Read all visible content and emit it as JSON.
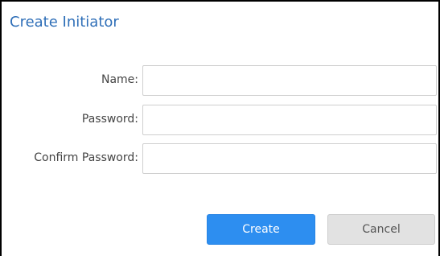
{
  "dialog": {
    "title": "Create Initiator"
  },
  "form": {
    "name": {
      "label": "Name:",
      "value": ""
    },
    "password": {
      "label": "Password:",
      "value": ""
    },
    "confirm_password": {
      "label": "Confirm Password:",
      "value": ""
    }
  },
  "buttons": {
    "create_label": "Create",
    "cancel_label": "Cancel"
  },
  "colors": {
    "title": "#2f6fb8",
    "primary_button": "#2d8ef0",
    "secondary_button": "#e2e2e2"
  }
}
